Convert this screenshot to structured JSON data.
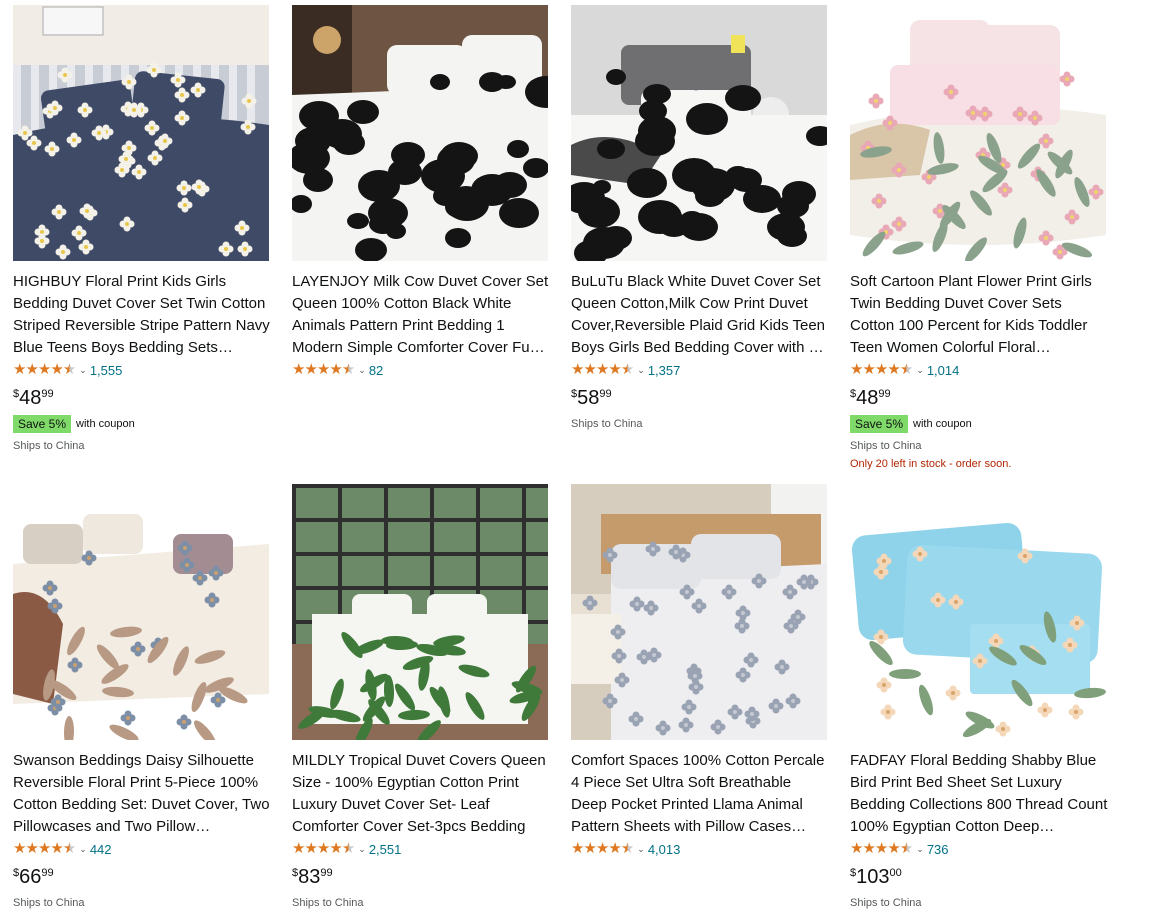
{
  "colors": {
    "star": "#de7921",
    "link": "#007185",
    "coupon": "#7fda69",
    "stock_warning": "#b12704"
  },
  "products": [
    {
      "title": "HIGHBUY Floral Print Kids Girls Bedding Duvet Cover Set Twin Cotton Striped Reversible Stripe Pattern Navy Blue Teens Boys Bedding Sets…",
      "rating": 4.5,
      "reviews": "1,555",
      "price_symbol": "$",
      "price_whole": "48",
      "price_fraction": "99",
      "coupon_badge": "Save 5%",
      "coupon_text": "with coupon",
      "ships": "Ships to China",
      "stock": "",
      "image": "navy-floral-bedding"
    },
    {
      "title": "LAYENJOY Milk Cow Duvet Cover Set Queen 100% Cotton Black White Animals Pattern Print Bedding 1 Modern Simple Comforter Cover Fu…",
      "rating": 4.5,
      "reviews": "82",
      "price_symbol": "",
      "price_whole": "",
      "price_fraction": "",
      "coupon_badge": "",
      "coupon_text": "",
      "ships": "",
      "stock": "",
      "image": "cow-print-bedding"
    },
    {
      "title": "BuLuTu Black White Duvet Cover Set Queen Cotton,Milk Cow Print Duvet Cover,Reversible Plaid Grid Kids Teen Boys Girls Bed Bedding Cover with …",
      "rating": 4.5,
      "reviews": "1,357",
      "price_symbol": "$",
      "price_whole": "58",
      "price_fraction": "99",
      "coupon_badge": "",
      "coupon_text": "",
      "ships": "Ships to China",
      "stock": "",
      "image": "cow-print-bedding-gray-headboard"
    },
    {
      "title": "Soft Cartoon Plant Flower Print Girls Twin Bedding Duvet Cover Sets Cotton 100 Percent for Kids Toddler Teen Women Colorful Floral…",
      "rating": 4.5,
      "reviews": "1,014",
      "price_symbol": "$",
      "price_whole": "48",
      "price_fraction": "99",
      "coupon_badge": "Save 5%",
      "coupon_text": "with coupon",
      "ships": "Ships to China",
      "stock": "Only 20 left in stock - order soon.",
      "image": "pastel-floral-bedding"
    },
    {
      "title": "Swanson Beddings Daisy Silhouette Reversible Floral Print 5-Piece 100% Cotton Bedding Set: Duvet Cover, Two Pillowcases and Two Pillow…",
      "rating": 4.5,
      "reviews": "442",
      "price_symbol": "$",
      "price_whole": "66",
      "price_fraction": "99",
      "coupon_badge": "",
      "coupon_text": "",
      "ships": "Ships to China",
      "stock": "",
      "image": "daisy-silhouette-bedding"
    },
    {
      "title": "MILDLY Tropical Duvet Covers Queen Size - 100% Egyptian Cotton Print Luxury Duvet Cover Set- Leaf Comforter Cover Set-3pcs Bedding",
      "rating": 4.5,
      "reviews": "2,551",
      "price_symbol": "$",
      "price_whole": "83",
      "price_fraction": "99",
      "coupon_badge": "",
      "coupon_text": "",
      "ships": "Ships to China",
      "stock": "",
      "image": "tropical-leaf-bedding"
    },
    {
      "title": "Comfort Spaces 100% Cotton Percale 4 Piece Set Ultra Soft Breathable Deep Pocket Printed Llama Animal Pattern Sheets with Pillow Cases…",
      "rating": 4.5,
      "reviews": "4,013",
      "price_symbol": "",
      "price_whole": "",
      "price_fraction": "",
      "coupon_badge": "",
      "coupon_text": "",
      "ships": "",
      "stock": "",
      "image": "llama-sheet-set"
    },
    {
      "title": "FADFAY Floral Bedding Shabby Blue Bird Print Bed Sheet Set Luxury Bedding Collections 800 Thread Count 100% Egyptian Cotton Deep…",
      "rating": 4.5,
      "reviews": "736",
      "price_symbol": "$",
      "price_whole": "103",
      "price_fraction": "00",
      "coupon_badge": "",
      "coupon_text": "",
      "ships": "Ships to China",
      "stock": "",
      "image": "blue-bird-floral-sheets"
    }
  ]
}
